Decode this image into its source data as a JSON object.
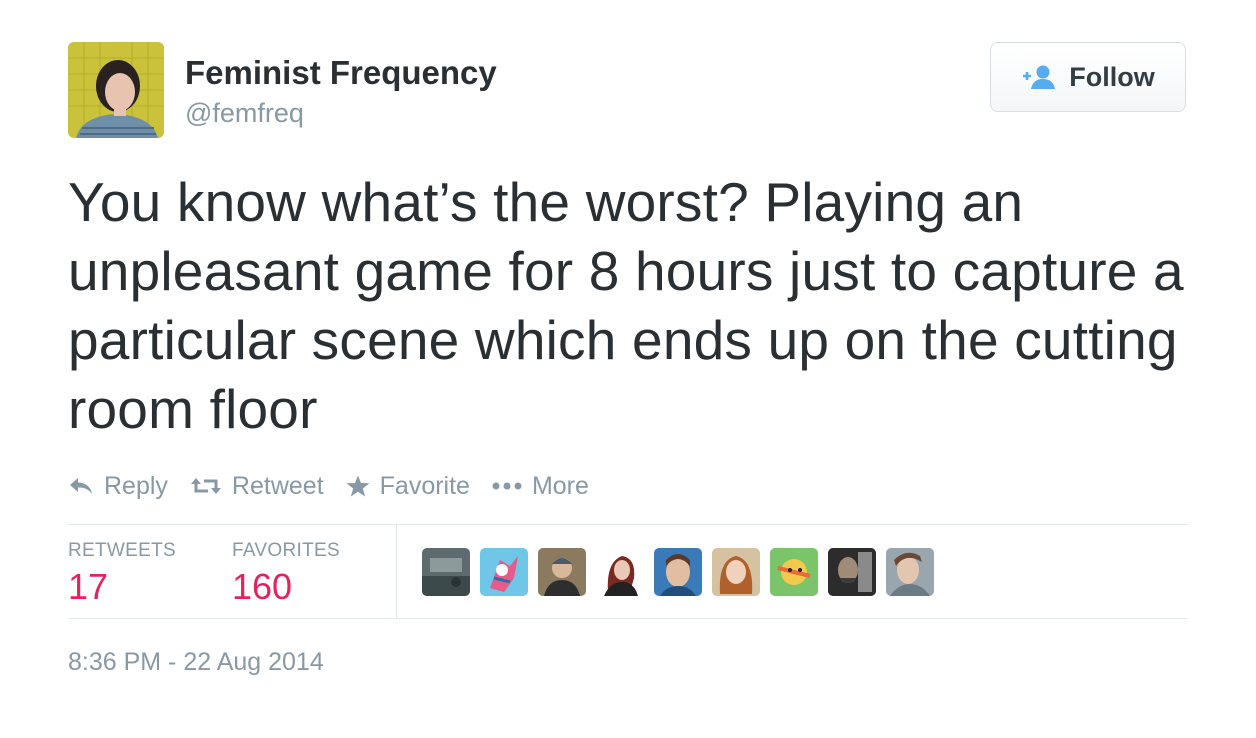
{
  "author": {
    "display_name": "Feminist Frequency",
    "handle": "@femfreq"
  },
  "follow": {
    "label": "Follow",
    "icon": "add-user-icon"
  },
  "tweet": {
    "text": "You know what’s the worst? Playing an unpleasant game for 8 hours just to capture a particular scene which ends up on the cutting room floor"
  },
  "actions": {
    "reply": "Reply",
    "retweet": "Retweet",
    "favorite": "Favorite",
    "more": "More"
  },
  "stats": {
    "retweets_label": "RETWEETS",
    "retweets_value": "17",
    "favorites_label": "FAVORITES",
    "favorites_value": "160"
  },
  "favoriters": [
    {
      "avatar": "user-avatar-1"
    },
    {
      "avatar": "user-avatar-2"
    },
    {
      "avatar": "user-avatar-3"
    },
    {
      "avatar": "user-avatar-4"
    },
    {
      "avatar": "user-avatar-5"
    },
    {
      "avatar": "user-avatar-6"
    },
    {
      "avatar": "user-avatar-7"
    },
    {
      "avatar": "user-avatar-8"
    },
    {
      "avatar": "user-avatar-9"
    }
  ],
  "timestamp": "8:36 PM - 22 Aug 2014",
  "colors": {
    "text": "#292f33",
    "muted": "#8899a6",
    "count": "#e0245e",
    "follow_icon": "#55acee"
  }
}
